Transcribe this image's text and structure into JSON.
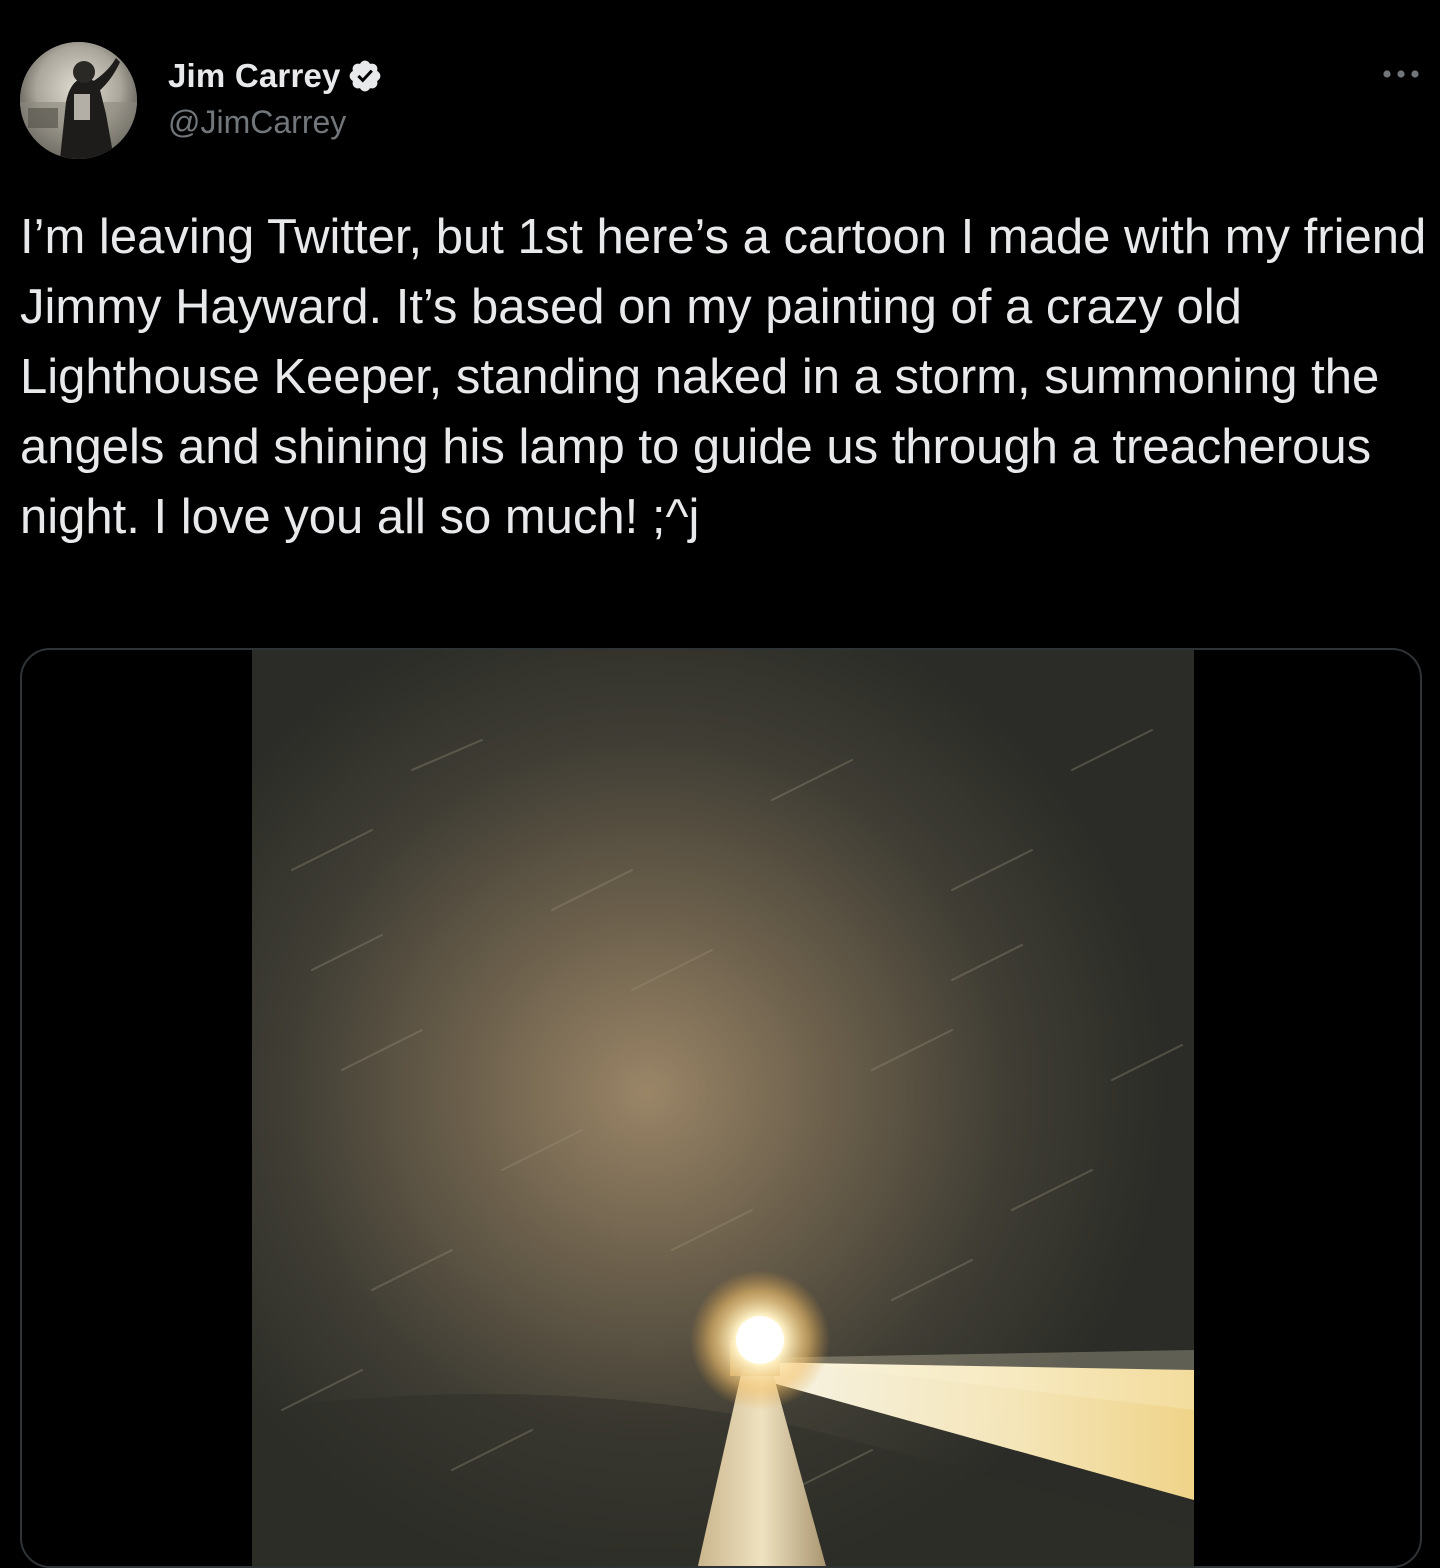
{
  "tweet": {
    "author": {
      "display_name": "Jim Carrey",
      "handle": "@JimCarrey",
      "verified": true,
      "avatar_icon": "profile-photo"
    },
    "more_icon": "more-options-icon",
    "text": "I’m leaving Twitter, but 1st here’s a cartoon I made with my friend Jimmy Hayward. It’s based on my painting of a crazy old Lighthouse Keeper, standing naked in a storm, summoning the angels and shining his lamp to guide us through a treacherous night. I love you all so much! ;^j",
    "media": {
      "type": "video",
      "scene": "lighthouse-beam-storm"
    }
  },
  "colors": {
    "background": "#000000",
    "primary_text": "#e7e9ea",
    "secondary_text": "#71767b",
    "border": "#2f3336",
    "verified_badge": "#e7e9ea"
  }
}
